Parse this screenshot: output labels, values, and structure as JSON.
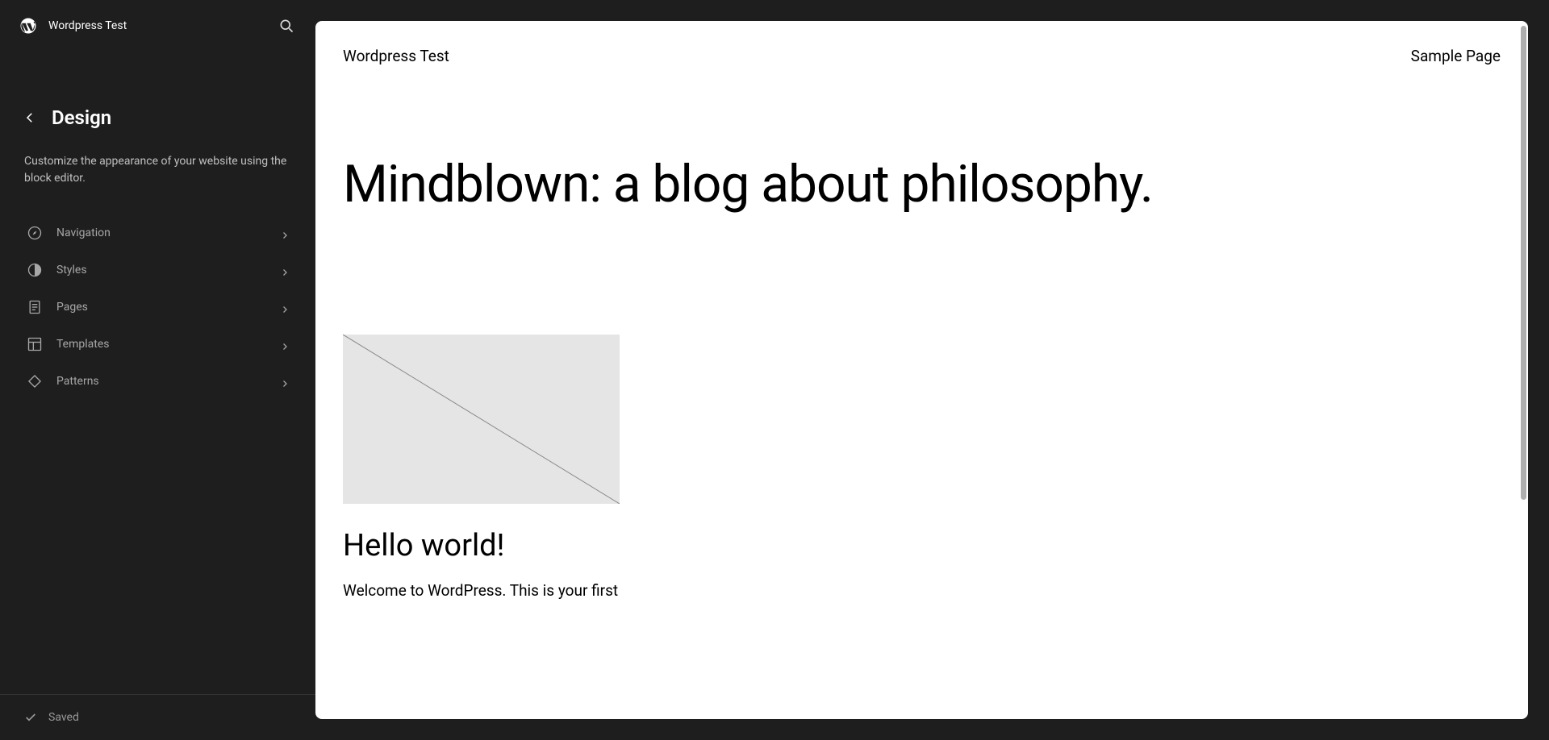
{
  "header": {
    "site_name": "Wordpress Test"
  },
  "section": {
    "title": "Design",
    "description": "Customize the appearance of your website using the block editor."
  },
  "menu": {
    "items": [
      {
        "label": "Navigation"
      },
      {
        "label": "Styles"
      },
      {
        "label": "Pages"
      },
      {
        "label": "Templates"
      },
      {
        "label": "Patterns"
      }
    ]
  },
  "footer": {
    "status": "Saved"
  },
  "preview": {
    "site_title": "Wordpress Test",
    "nav_link": "Sample Page",
    "hero": "Mindblown: a blog about philosophy.",
    "post": {
      "title": "Hello world!",
      "excerpt": "Welcome to WordPress. This is your first"
    }
  }
}
